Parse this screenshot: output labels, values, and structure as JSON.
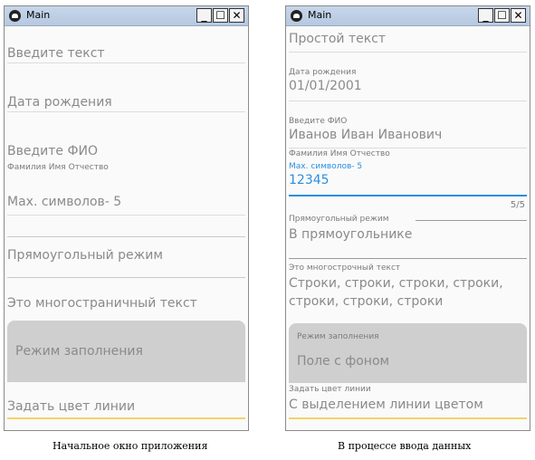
{
  "left_window": {
    "title": "Main",
    "hints": {
      "text": "Введите текст",
      "date": "Дата рождения",
      "fio": "Введите ФИО",
      "fio_helper": "Фамилия Имя Отчество",
      "max": "Max. символов- 5",
      "rect": "Прямоугольный режим",
      "multi": "Это многостраничный текст",
      "fill": "Режим заполнения",
      "color": "Задать цвет линии"
    }
  },
  "right_window": {
    "title": "Main",
    "simple_text": "Простой текст",
    "date_label": "Дата рождения",
    "date_value": "01/01/2001",
    "fio_label": "Введите ФИО",
    "fio_value": "Иванов Иван Иванович",
    "fio_helper": "Фамилия Имя Отчество",
    "max_label": "Max. символов- 5",
    "max_value": "12345",
    "max_counter": "5/5",
    "rect_label": "Прямоугольный режим",
    "rect_value": "В прямоугольнике",
    "multi_label": "Это многострочный текст",
    "multi_value_line1": "Строки, строки, строки, строки,",
    "multi_value_line2": "строки, строки, строки",
    "fill_label": "Режим заполнения",
    "fill_value": "Поле с фоном",
    "color_label": "Задать цвет линии",
    "color_value": "С выделением линии цветом"
  },
  "captions": {
    "left": "Начальное окно приложения",
    "right": "В процессе ввода данных"
  },
  "colors": {
    "focus_blue": "#2b8fe0",
    "accent_yellow": "#f2d36b",
    "title_bar": "#bccde3",
    "filled_bg": "#cfcfcf"
  }
}
